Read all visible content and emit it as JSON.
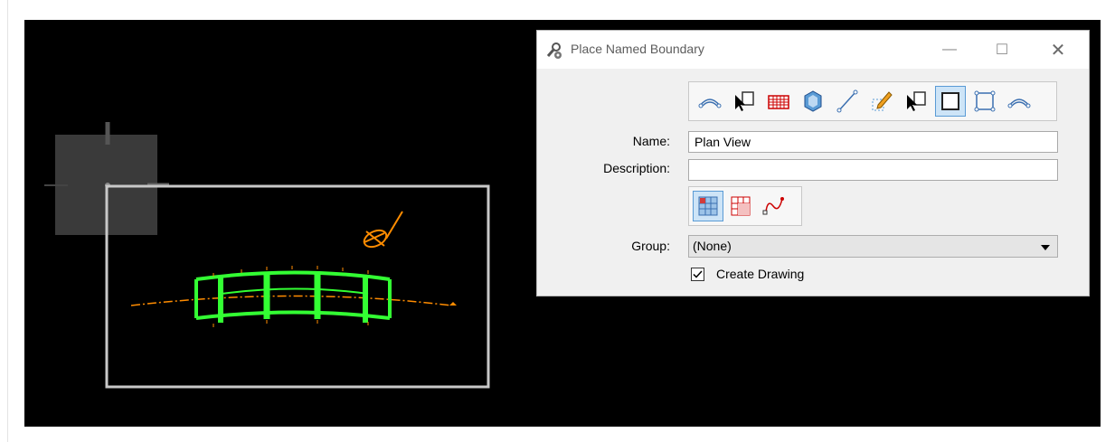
{
  "dialog": {
    "title": "Place Named Boundary",
    "controls": {
      "minimize": "—",
      "maximize": "☐",
      "close": "✕"
    },
    "toolbar_icons": [
      "path-boundary-icon",
      "select-element-icon",
      "grid-boundary-icon",
      "volume-icon",
      "two-point-line-icon",
      "draw-icon",
      "select-region-icon",
      "rectangle-boundary-icon",
      "shape-boundary-icon",
      "path-profile-icon"
    ],
    "active_tool_index": 7,
    "name_label": "Name:",
    "name_value": "Plan View",
    "description_label": "Description:",
    "description_value": "",
    "mode_icons": [
      "grid-fill-icon",
      "grid-icon",
      "curve-icon"
    ],
    "group_label": "Group:",
    "group_value": "(None)",
    "create_drawing_label": "Create Drawing",
    "create_drawing_checked": true
  },
  "colors": {
    "viewport_bg": "#000000",
    "element_green": "#33ff33",
    "centerline_orange": "#ff8c00",
    "boundary_gray": "#c8c8c8",
    "accent_blue": "#5a9bd5"
  }
}
